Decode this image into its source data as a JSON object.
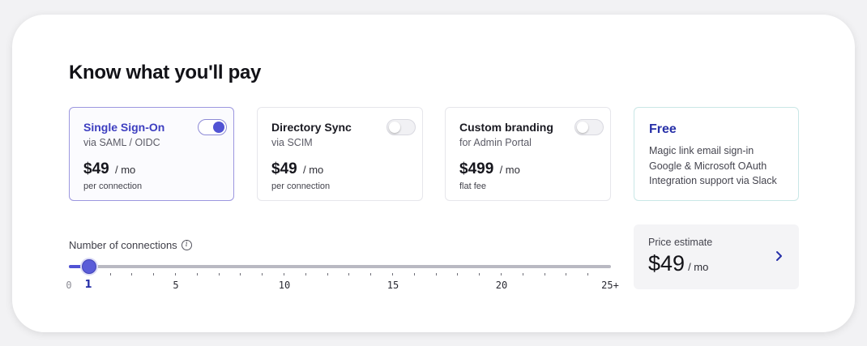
{
  "title": "Know what you'll pay",
  "options": [
    {
      "name": "Single Sign-On",
      "sub": "via SAML / OIDC",
      "price": "$49",
      "unit": "/ mo",
      "note": "per connection",
      "enabled": true
    },
    {
      "name": "Directory Sync",
      "sub": "via SCIM",
      "price": "$49",
      "unit": "/ mo",
      "note": "per connection",
      "enabled": false
    },
    {
      "name": "Custom branding",
      "sub": "for Admin Portal",
      "price": "$499",
      "unit": "/ mo",
      "note": "flat fee",
      "enabled": false
    }
  ],
  "free": {
    "title": "Free",
    "features": [
      "Magic link email sign-in",
      "Google & Microsoft OAuth",
      "Integration support via Slack"
    ]
  },
  "connections": {
    "label": "Number of connections",
    "info_icon": "info-icon",
    "value": 1,
    "min": 0,
    "max": 25,
    "tick_labels": [
      "0",
      "1",
      "5",
      "10",
      "15",
      "20",
      "25+"
    ]
  },
  "estimate": {
    "label": "Price estimate",
    "value": "$49",
    "unit": "/ mo",
    "icon": "chevron-right-icon"
  },
  "colors": {
    "accent": "#5153d4",
    "accent_text": "#2730a8",
    "free_border": "#c9e7e6"
  }
}
